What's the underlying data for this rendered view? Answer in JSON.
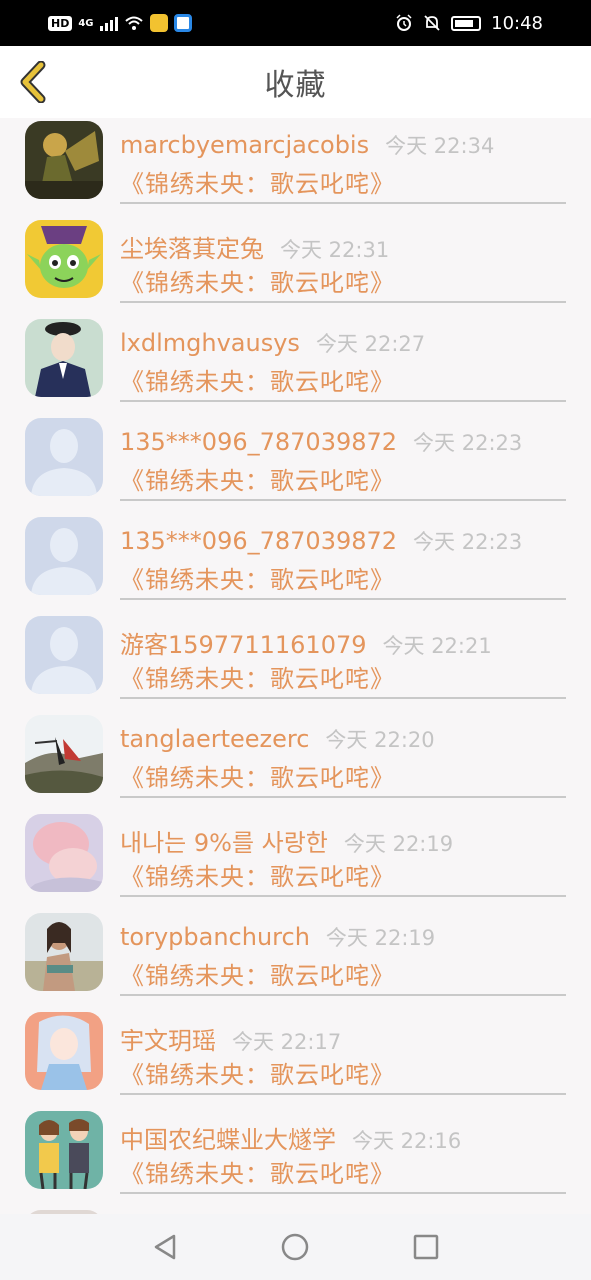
{
  "status_bar": {
    "network_badge": "HD",
    "network_type": "4G",
    "time": "10:48",
    "icons": [
      "signal-icon",
      "wifi-icon",
      "app-icon-1",
      "app-icon-2",
      "alarm-icon",
      "mute-icon",
      "battery-icon"
    ]
  },
  "header": {
    "title": "收藏",
    "back_icon": "chevron-left-icon"
  },
  "favorites": [
    {
      "username": "marcbyemarcjacobis",
      "time": "今天 22:34",
      "title": "《锦绣未央：歌云叱咤》",
      "avatar": "game-character-avatar"
    },
    {
      "username": "尘埃落萁定兔",
      "time": "今天 22:31",
      "title": "《锦绣未央：歌云叱咤》",
      "avatar": "orc-cartoon-avatar"
    },
    {
      "username": "lxdlmghvausys",
      "time": "今天 22:27",
      "title": "《锦绣未央：歌云叱咤》",
      "avatar": "uniform-illustration-avatar"
    },
    {
      "username": "135***096_787039872",
      "time": "今天 22:23",
      "title": "《锦绣未央：歌云叱咤》",
      "avatar": "default-avatar"
    },
    {
      "username": "135***096_787039872",
      "time": "今天 22:23",
      "title": "《锦绣未央：歌云叱咤》",
      "avatar": "default-avatar"
    },
    {
      "username": "游客1597711161079",
      "time": "今天 22:21",
      "title": "《锦绣未央：歌云叱咤》",
      "avatar": "default-avatar"
    },
    {
      "username": "tanglaerteezerc",
      "time": "今天 22:20",
      "title": "《锦绣未央：歌云叱咤》",
      "avatar": "couple-cliff-avatar"
    },
    {
      "username": "내나는 9%를 사랑한",
      "time": "今天 22:19",
      "title": "《锦绣未央：歌云叱咤》",
      "avatar": "pink-hair-avatar"
    },
    {
      "username": "torypbanchurch",
      "time": "今天 22:19",
      "title": "《锦绣未央：歌云叱咤》",
      "avatar": "beach-woman-avatar"
    },
    {
      "username": "宇文玥瑶",
      "time": "今天 22:17",
      "title": "《锦绣未央：歌云叱咤》",
      "avatar": "anime-girl-avatar"
    },
    {
      "username": "中国农纪蝶业大燧学",
      "time": "今天 22:16",
      "title": "《锦绣未央：歌云叱咤》",
      "avatar": "cartoon-couple-avatar"
    }
  ],
  "nav_bar": {
    "buttons": [
      "back-triangle-icon",
      "home-circle-icon",
      "recents-square-icon"
    ]
  },
  "colors": {
    "accent": "#e4955c",
    "timestamp": "#c4c4c4",
    "background": "#f8f6f7",
    "back_icon": "#e7c23a"
  }
}
